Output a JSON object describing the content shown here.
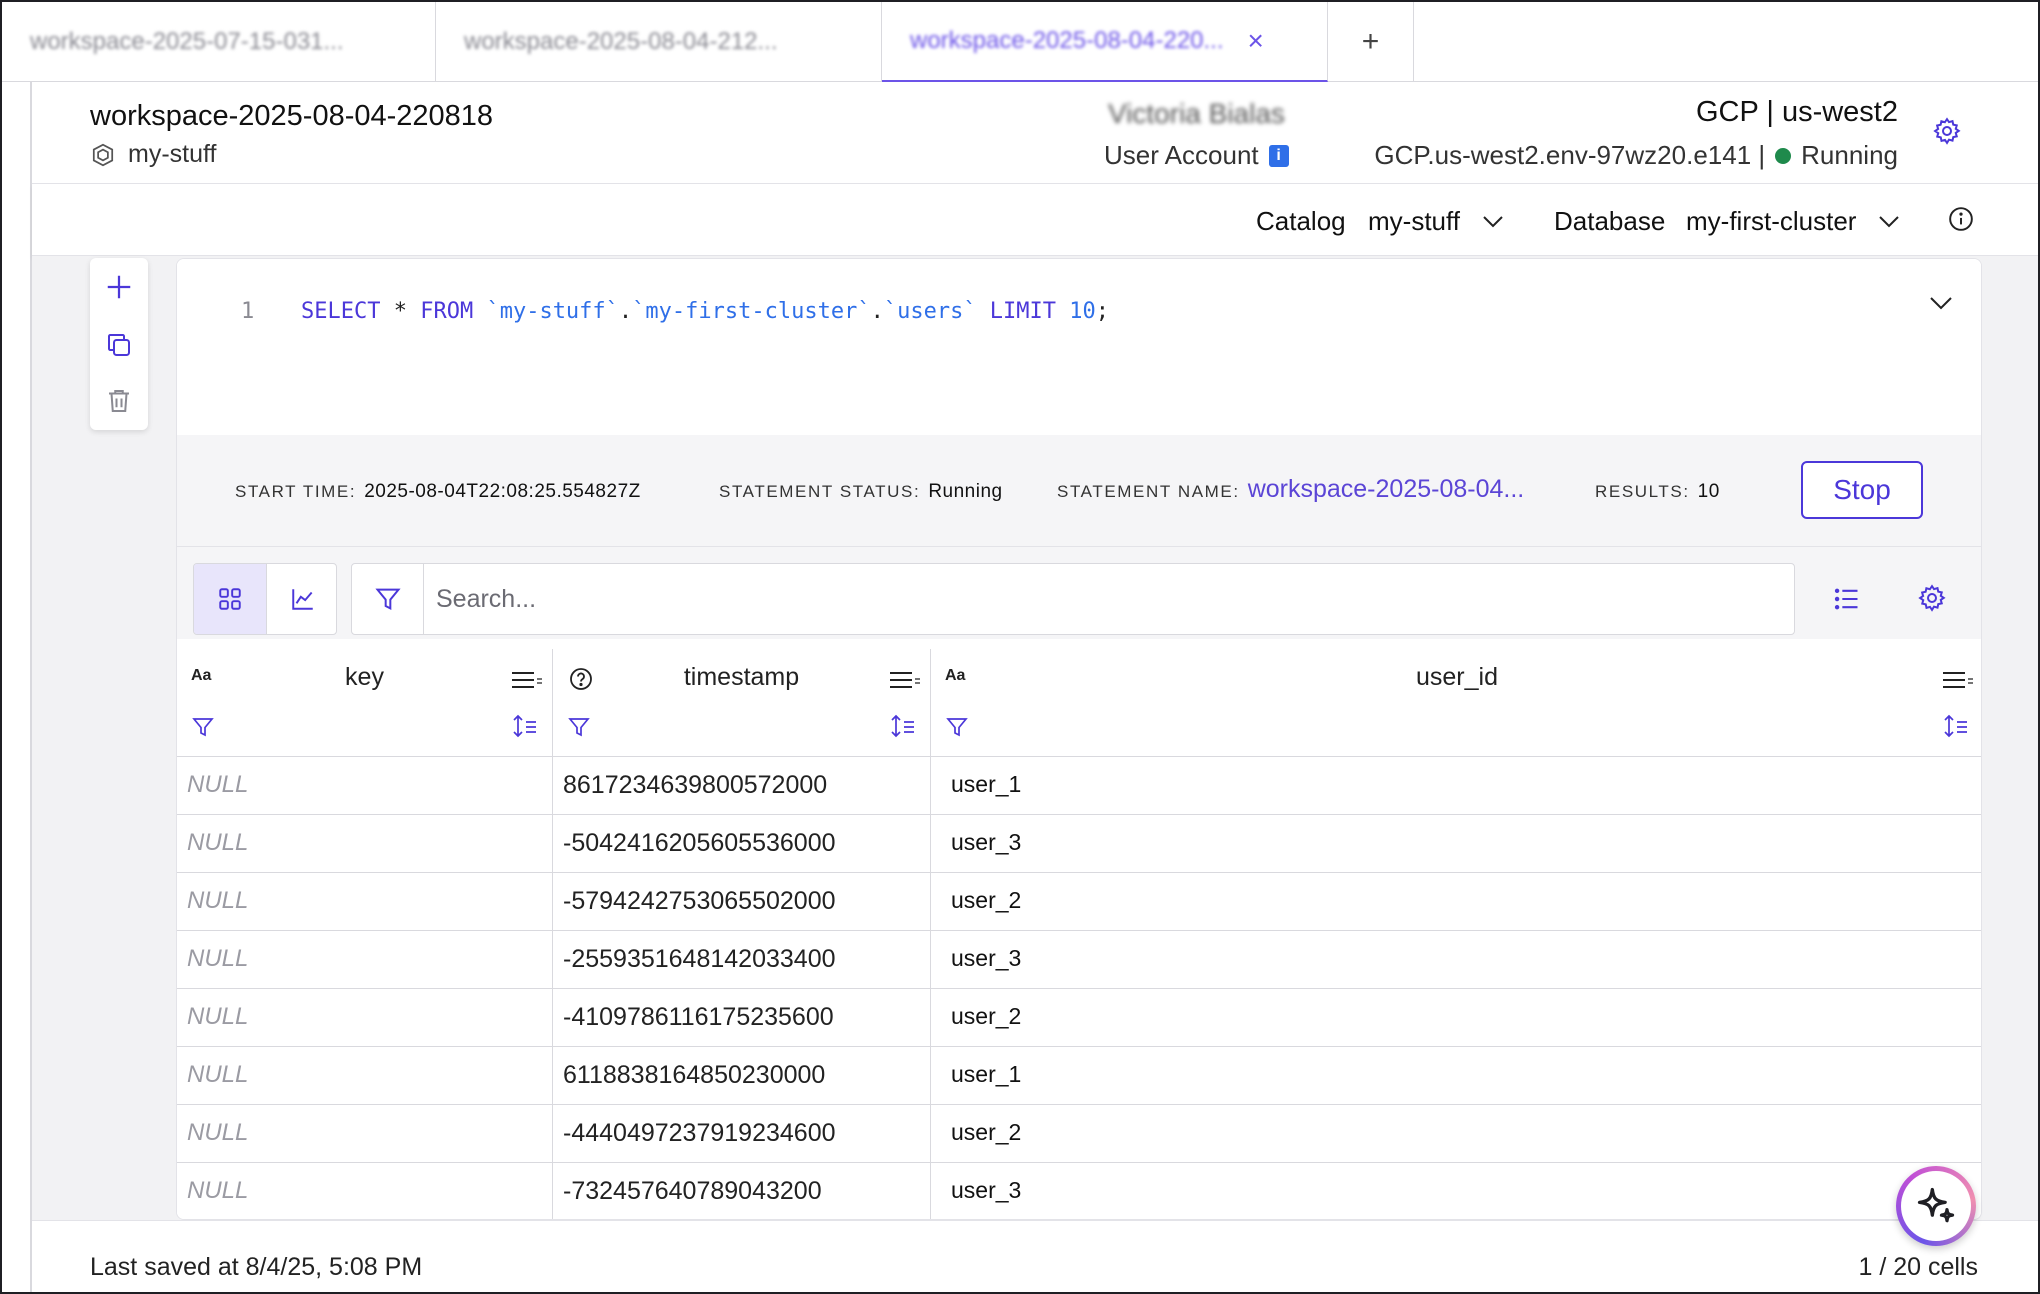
{
  "tabs": [
    {
      "label": "workspace-2025-07-15-031..."
    },
    {
      "label": "workspace-2025-08-04-212..."
    },
    {
      "label": "workspace-2025-08-04-220...",
      "active": true
    }
  ],
  "tab_add_label": "+",
  "tab_close_label": "×",
  "header": {
    "title": "workspace-2025-08-04-220818",
    "environment": "my-stuff",
    "user_name": "Victoria Bialas",
    "user_account_label": "User Account",
    "info_badge": "i",
    "cloud_region": "GCP | us-west2",
    "env_id": "GCP.us-west2.env-97wz20.e141 |",
    "status": "Running",
    "status_color": "#1f8a4c"
  },
  "catalog_bar": {
    "catalog_label": "Catalog",
    "catalog_value": "my-stuff",
    "database_label": "Database",
    "database_value": "my-first-cluster"
  },
  "editor": {
    "line_number": "1",
    "code_parts": {
      "select": "SELECT",
      "star": " * ",
      "from": "FROM",
      "catalog": " `my-stuff`",
      "dot1": ".",
      "db": "`my-first-cluster`",
      "dot2": ".",
      "table": "`users`",
      "limit": " LIMIT",
      "limit_val": " 10",
      "semicolon": ";"
    }
  },
  "statement": {
    "start_time_label": "START TIME:",
    "start_time": "2025-08-04T22:08:25.554827Z",
    "status_label": "STATEMENT STATUS:",
    "status": "Running",
    "name_label": "STATEMENT NAME:",
    "name": "workspace-2025-08-04...",
    "results_label": "RESULTS:",
    "results": "10",
    "stop_label": "Stop"
  },
  "search": {
    "placeholder": "Search..."
  },
  "columns": [
    {
      "name": "key",
      "type_icon": "Aa"
    },
    {
      "name": "timestamp",
      "type_icon": "question-circle-icon"
    },
    {
      "name": "user_id",
      "type_icon": "Aa"
    }
  ],
  "rows": [
    {
      "key": "NULL",
      "timestamp": "8617234639800572000",
      "user_id": "user_1"
    },
    {
      "key": "NULL",
      "timestamp": "-5042416205605536000",
      "user_id": "user_3"
    },
    {
      "key": "NULL",
      "timestamp": "-5794242753065502000",
      "user_id": "user_2"
    },
    {
      "key": "NULL",
      "timestamp": "-2559351648142033400",
      "user_id": "user_3"
    },
    {
      "key": "NULL",
      "timestamp": "-4109786116175235600",
      "user_id": "user_2"
    },
    {
      "key": "NULL",
      "timestamp": "6118838164850230000",
      "user_id": "user_1"
    },
    {
      "key": "NULL",
      "timestamp": "-4440497237919234600",
      "user_id": "user_2"
    },
    {
      "key": "NULL",
      "timestamp": "-732457640789043200",
      "user_id": "user_3"
    }
  ],
  "footer": {
    "last_saved": "Last saved at 8/4/25, 5:08 PM",
    "cells": "1 / 20 cells"
  },
  "accent_color": "#4b37d9"
}
